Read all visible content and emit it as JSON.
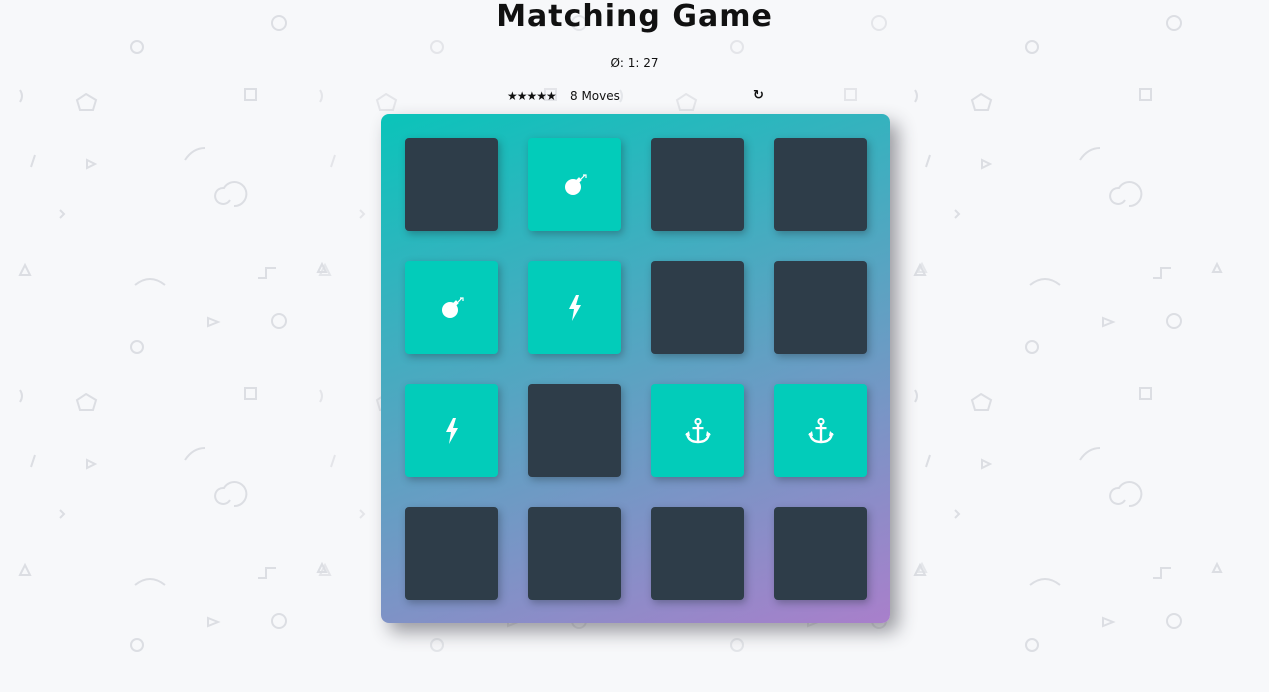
{
  "title": "Matching Game",
  "timer": "Ø: 1: 27",
  "score": {
    "stars": "★★★★★",
    "moves": "8 Moves",
    "restart_icon": "↻"
  },
  "deck": {
    "cards": [
      {
        "state": "closed",
        "icon": ""
      },
      {
        "state": "open",
        "icon": "bomb-icon"
      },
      {
        "state": "closed",
        "icon": ""
      },
      {
        "state": "closed",
        "icon": ""
      },
      {
        "state": "open",
        "icon": "bomb-icon"
      },
      {
        "state": "open",
        "icon": "bolt-icon"
      },
      {
        "state": "closed",
        "icon": ""
      },
      {
        "state": "closed",
        "icon": ""
      },
      {
        "state": "open",
        "icon": "bolt-icon"
      },
      {
        "state": "closed",
        "icon": ""
      },
      {
        "state": "open",
        "icon": "anchor-icon"
      },
      {
        "state": "open",
        "icon": "anchor-icon"
      },
      {
        "state": "closed",
        "icon": ""
      },
      {
        "state": "closed",
        "icon": ""
      },
      {
        "state": "closed",
        "icon": ""
      },
      {
        "state": "closed",
        "icon": ""
      }
    ]
  },
  "colors": {
    "card_closed": "#2e3d49",
    "card_open": "#02ccba",
    "deck_gradient_start": "#0ac4ba",
    "deck_gradient_end": "#a97fcb"
  }
}
